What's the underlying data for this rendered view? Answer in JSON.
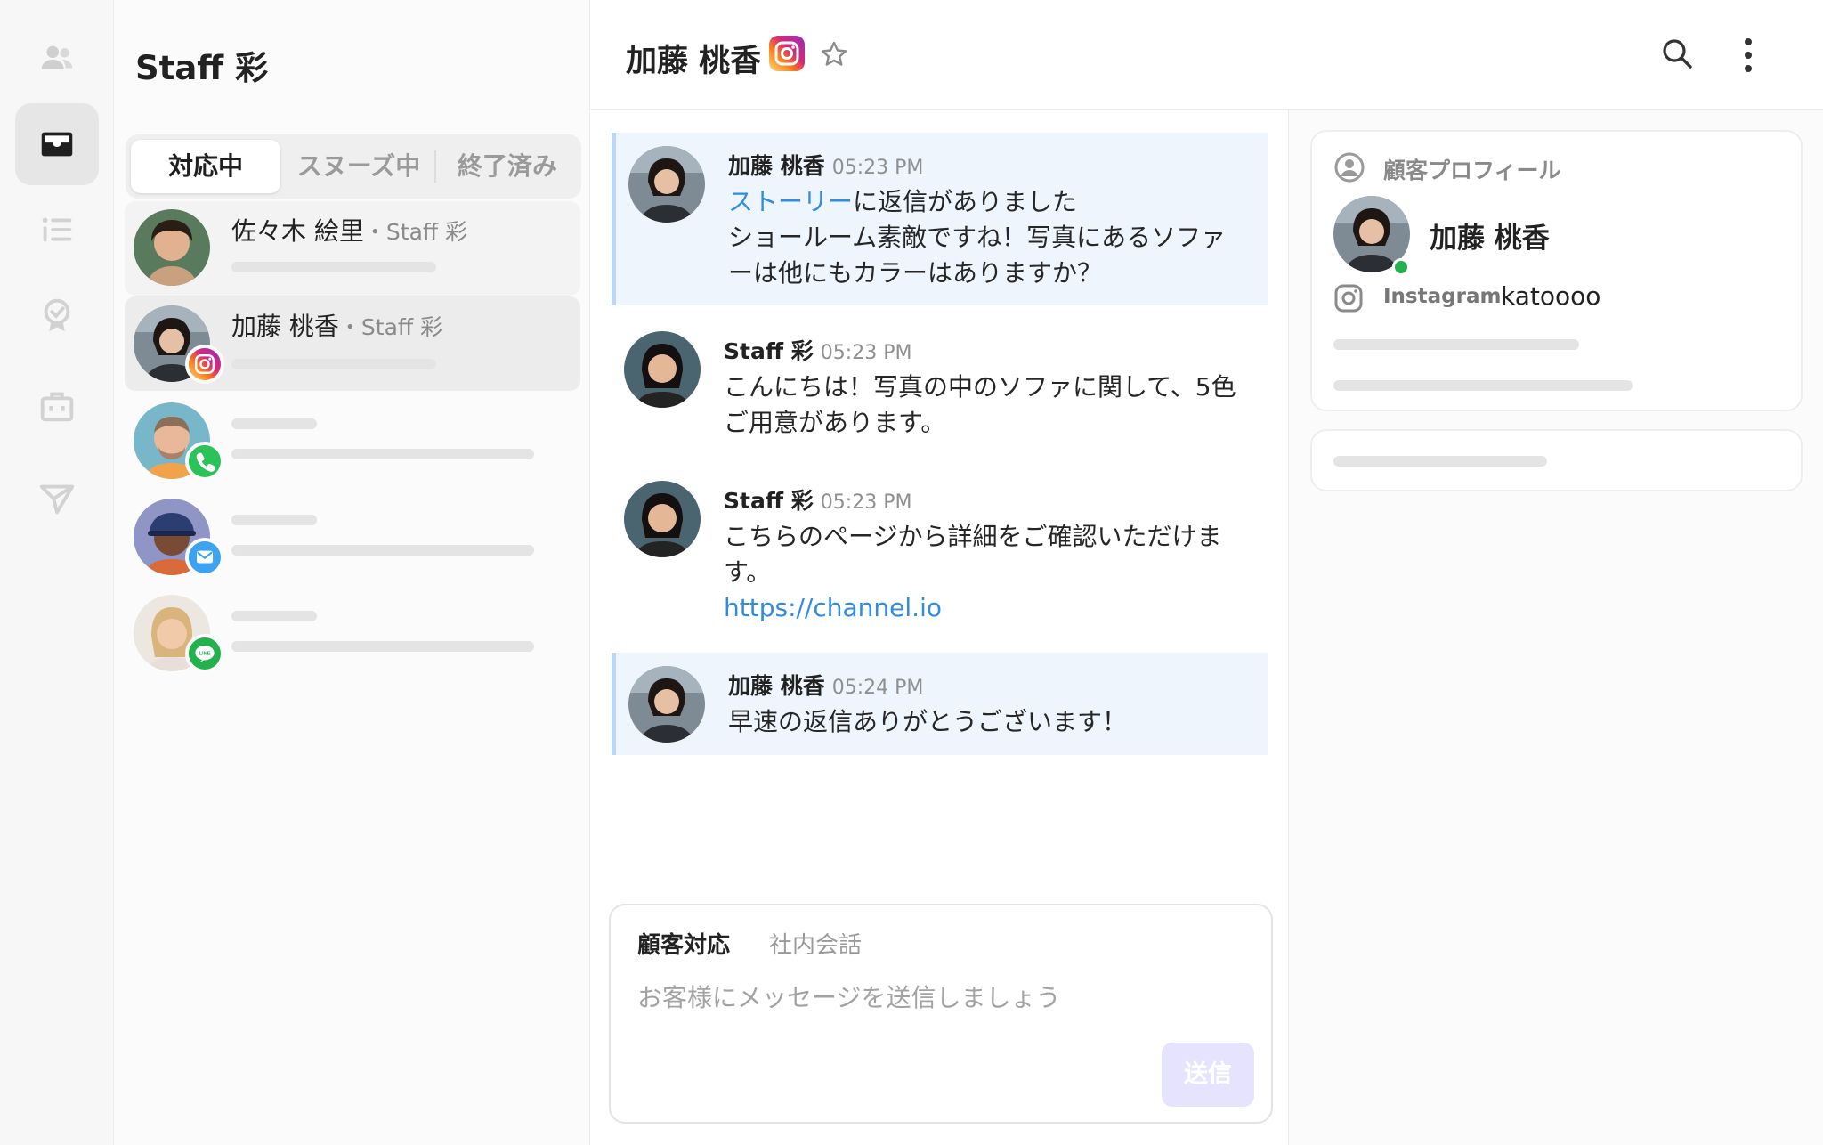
{
  "colors": {
    "accent_blue": "#2f8ce0",
    "customer_bubble": "#eef5fd",
    "send_button": "#e6e3ff",
    "online": "#22b14c"
  },
  "rail": {
    "items": [
      {
        "icon": "people-icon"
      },
      {
        "icon": "inbox-icon",
        "active": true
      },
      {
        "icon": "list-icon"
      },
      {
        "icon": "badge-icon"
      },
      {
        "icon": "briefcase-icon"
      },
      {
        "icon": "send-icon"
      }
    ]
  },
  "sidebar": {
    "title": "Staff 彩",
    "tabs": [
      {
        "label": "対応中",
        "active": true
      },
      {
        "label": "スヌーズ中",
        "active": false
      },
      {
        "label": "終了済み",
        "active": false
      }
    ],
    "conversations": [
      {
        "name": "佐々木 絵里",
        "assignee": "・Staff 彩",
        "channel_icon": null
      },
      {
        "name": "加藤 桃香",
        "assignee": "・Staff 彩",
        "channel_icon": "instagram-icon",
        "selected": true
      },
      {
        "name": "",
        "assignee": "",
        "channel_icon": "phone-icon"
      },
      {
        "name": "",
        "assignee": "",
        "channel_icon": "mail-icon"
      },
      {
        "name": "",
        "assignee": "",
        "channel_icon": "line-icon"
      }
    ]
  },
  "chat": {
    "title": "加藤 桃香",
    "messages": [
      {
        "sender": "加藤 桃香",
        "time": "05:23 PM",
        "story": "ストーリー",
        "story_suffix": "に返信がありました",
        "text": "ショールーム素敵ですね！写真にあるソファーは他にもカラーはありますか？"
      },
      {
        "sender": "Staff 彩",
        "time": "05:23 PM",
        "text": "こんにちは！写真の中のソファに関して、5色ご用意があります。"
      },
      {
        "sender": "Staff 彩",
        "time": "05:23 PM",
        "text": "こちらのページから詳細をご確認いただけます。",
        "link": "https://channel.io"
      },
      {
        "sender": "加藤 桃香",
        "time": "05:24 PM",
        "text": "早速の返信ありがとうございます！"
      }
    ],
    "composer": {
      "tab_customer": "顧客対応",
      "tab_internal": "社内会話",
      "placeholder": "お客様にメッセージを送信しましょう",
      "send_label": "送信"
    }
  },
  "profile": {
    "card_title": "顧客プロフィール",
    "name": "加藤 桃香",
    "channel_label": "Instagram",
    "handle": "katoooo"
  }
}
